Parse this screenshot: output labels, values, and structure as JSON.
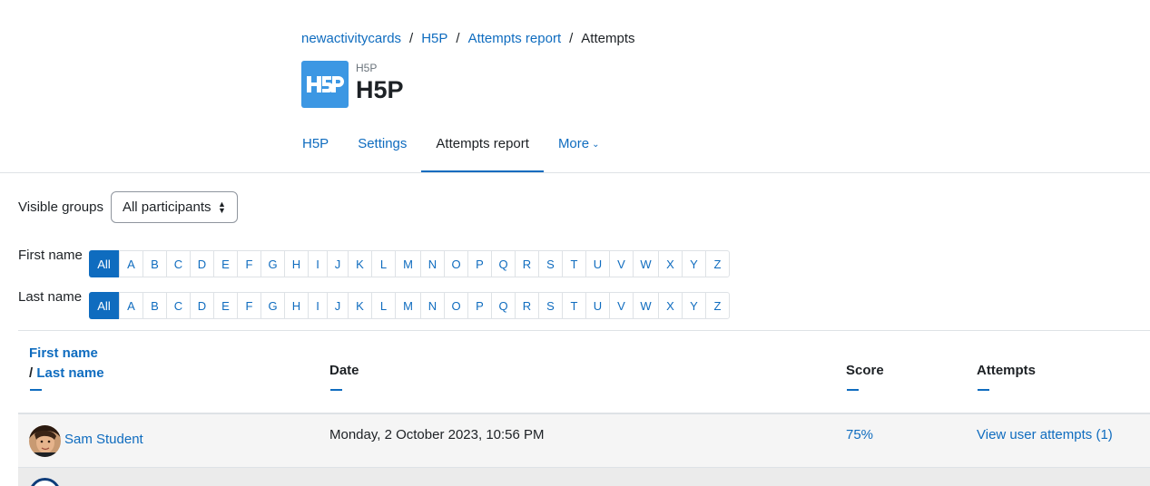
{
  "breadcrumb": {
    "items": [
      "newactivitycards",
      "H5P",
      "Attempts report"
    ],
    "current": "Attempts",
    "separator": "/"
  },
  "header": {
    "pretitle": "H5P",
    "title": "H5P",
    "logo_icon": "h5p-logo-icon"
  },
  "tabs": [
    {
      "label": "H5P"
    },
    {
      "label": "Settings"
    },
    {
      "label": "Attempts report",
      "active": true
    },
    {
      "label": "More"
    }
  ],
  "groups": {
    "label": "Visible groups",
    "selected": "All participants"
  },
  "initials": {
    "first_label": "First name",
    "last_label": "Last name",
    "all_label": "All",
    "letters": [
      "A",
      "B",
      "C",
      "D",
      "E",
      "F",
      "G",
      "H",
      "I",
      "J",
      "K",
      "L",
      "M",
      "N",
      "O",
      "P",
      "Q",
      "R",
      "S",
      "T",
      "U",
      "V",
      "W",
      "X",
      "Y",
      "Z"
    ]
  },
  "table": {
    "columns": {
      "first_name": "First name",
      "name_sep": "/",
      "last_name": "Last name",
      "date": "Date",
      "score": "Score",
      "attempts": "Attempts"
    },
    "rows": [
      {
        "name": "Sam Student",
        "date": "Monday, 2 October 2023, 10:56 PM",
        "score": "75%",
        "attempts": "View user attempts (1)"
      }
    ]
  },
  "colors": {
    "accent": "#0f6cbf",
    "h5p_blue": "#3c97e3",
    "text": "#1d2125"
  }
}
